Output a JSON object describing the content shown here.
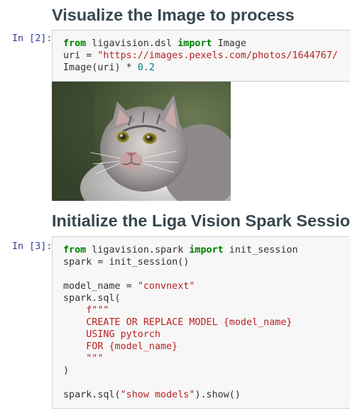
{
  "cell1": {
    "heading": "Visualize the Image to process",
    "prompt": "In [2]:",
    "code": {
      "l1_kw1": "from",
      "l1_mod": " ligavision.dsl ",
      "l1_kw2": "import",
      "l1_name": " Image",
      "l2_pre": "uri = ",
      "l2_str": "\"https://images.pexels.com/photos/1644767/",
      "l3_pre": "Image(uri) * ",
      "l3_num": "0.2"
    }
  },
  "cell2": {
    "heading": "Initialize the Liga Vision Spark Session",
    "prompt": "In [3]:",
    "code": {
      "l1_kw1": "from",
      "l1_mod": " ligavision.spark ",
      "l1_kw2": "import",
      "l1_name": " init_session",
      "l2": "spark = init_session()",
      "l4_pre": "model_name = ",
      "l4_str": "\"convnext\"",
      "l5": "spark.sql(",
      "l6_indent": "    ",
      "l6_str": "f\"\"\"",
      "l7_indent": "    ",
      "l7_str": "CREATE OR REPLACE MODEL {model_name}",
      "l8_indent": "    ",
      "l8_str": "USING pytorch",
      "l9_indent": "    ",
      "l9_str": "FOR {model_name}",
      "l10_indent": "    ",
      "l10_str": "\"\"\"",
      "l11": ")",
      "l13_pre": "spark.sql(",
      "l13_str": "\"show models\"",
      "l13_post": ").show()"
    }
  },
  "output": {
    "image_desc": "cat-photo"
  }
}
